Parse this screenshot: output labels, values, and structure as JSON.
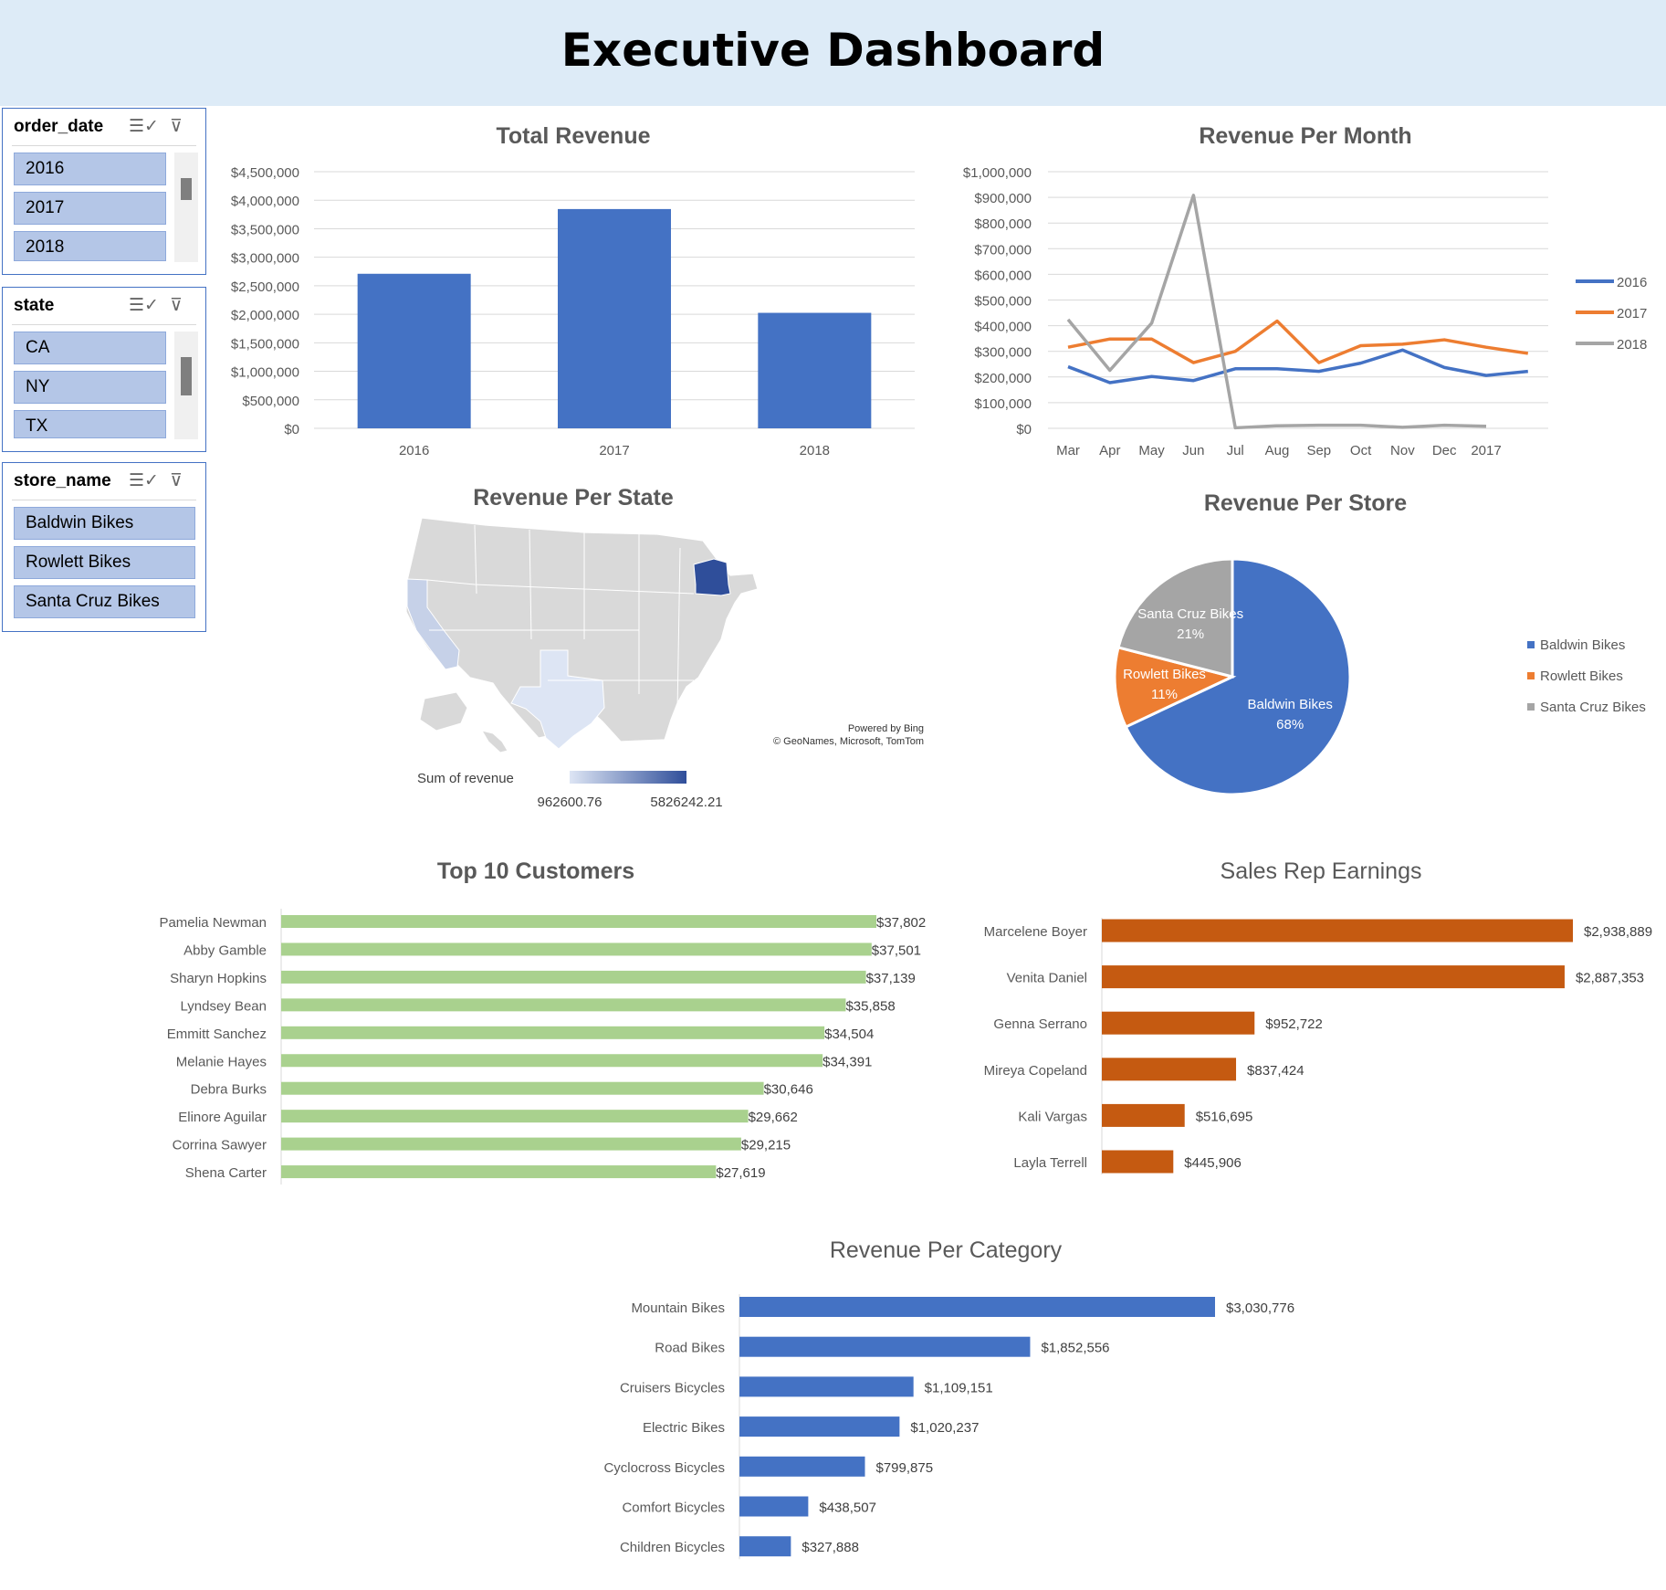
{
  "dashboard": {
    "title": "Executive Dashboard"
  },
  "slicers": [
    {
      "title": "order_date",
      "items": [
        "2016",
        "2017",
        "2018"
      ]
    },
    {
      "title": "state",
      "items": [
        "CA",
        "NY",
        "TX"
      ]
    },
    {
      "title": "store_name",
      "items": [
        "Baldwin Bikes",
        "Rowlett Bikes",
        "Santa Cruz Bikes"
      ]
    }
  ],
  "icons": {
    "multi_select": "multi-select-icon",
    "clear_filter": "clear-filter-icon"
  },
  "colors": {
    "blue": "#4472c4",
    "orange": "#ed7d31",
    "gray": "#a5a5a5",
    "green": "#a9d18e",
    "rust": "#c55a11",
    "banner": "#ddebf7",
    "map_low": "#dde5f4",
    "map_high": "#2f4e9a",
    "map_base": "#d9d9d9"
  },
  "chart_data": [
    {
      "id": "total_revenue",
      "type": "bar",
      "title": "Total Revenue",
      "categories": [
        "2016",
        "2017",
        "2018"
      ],
      "values": [
        2710000,
        3845000,
        2025000
      ],
      "ylim": [
        0,
        4500000
      ],
      "yticks": [
        "$0",
        "$500,000",
        "$1,000,000",
        "$1,500,000",
        "$2,000,000",
        "$2,500,000",
        "$3,000,000",
        "$3,500,000",
        "$4,000,000",
        "$4,500,000"
      ],
      "grid": true
    },
    {
      "id": "revenue_per_month",
      "type": "line",
      "title": "Revenue Per Month",
      "categories": [
        "Mar",
        "Apr",
        "May",
        "Jun",
        "Jul",
        "Aug",
        "Sep",
        "Oct",
        "Nov",
        "Dec",
        "2017",
        ""
      ],
      "ylim": [
        0,
        1000000
      ],
      "yticks": [
        "$0",
        "$100,000",
        "$200,000",
        "$300,000",
        "$400,000",
        "$500,000",
        "$600,000",
        "$700,000",
        "$800,000",
        "$900,000",
        "$1,000,000"
      ],
      "series": [
        {
          "name": "2016",
          "color": "#4472c4",
          "values": [
            240000,
            178000,
            202000,
            186000,
            232000,
            232000,
            222000,
            254000,
            305000,
            237000,
            206000,
            222000
          ]
        },
        {
          "name": "2017",
          "color": "#ed7d31",
          "values": [
            316000,
            348000,
            348000,
            256000,
            300000,
            418000,
            256000,
            322000,
            328000,
            345000,
            316000,
            292000
          ]
        },
        {
          "name": "2018",
          "color": "#a5a5a5",
          "values": [
            424000,
            226000,
            410000,
            908000,
            2000,
            10000,
            12000,
            12000,
            4000,
            12000,
            8000,
            null
          ]
        }
      ],
      "legend": "right",
      "grid": true
    },
    {
      "id": "revenue_per_state",
      "type": "map",
      "title": "Revenue Per State",
      "states": [
        {
          "name": "CA",
          "value": 1605823.03
        },
        {
          "name": "NY",
          "value": 5826242.21
        },
        {
          "name": "TX",
          "value": 962600.76
        }
      ],
      "legend_label": "Sum of revenue",
      "legend_min": "962600.76",
      "legend_max": "5826242.21",
      "credit_line1": "Powered by Bing",
      "credit_line2": "© GeoNames, Microsoft, TomTom"
    },
    {
      "id": "revenue_per_store",
      "type": "pie",
      "title": "Revenue Per Store",
      "slices": [
        {
          "name": "Baldwin Bikes",
          "value": 68,
          "label": "68%",
          "color": "#4472c4"
        },
        {
          "name": "Rowlett Bikes",
          "value": 11,
          "label": "11%",
          "color": "#ed7d31"
        },
        {
          "name": "Santa Cruz Bikes",
          "value": 21,
          "label": "21%",
          "color": "#a5a5a5"
        }
      ],
      "legend": "right"
    },
    {
      "id": "top_customers",
      "type": "bar",
      "orientation": "horizontal",
      "title": "Top 10 Customers",
      "categories": [
        "Pamelia Newman",
        "Abby Gamble",
        "Sharyn Hopkins",
        "Lyndsey Bean",
        "Emmitt Sanchez",
        "Melanie Hayes",
        "Debra Burks",
        "Elinore Aguilar",
        "Corrina Sawyer",
        "Shena Carter"
      ],
      "values": [
        37802,
        37501,
        37139,
        35858,
        34504,
        34391,
        30646,
        29662,
        29215,
        27619
      ],
      "labels": [
        "$37,802",
        "$37,501",
        "$37,139",
        "$35,858",
        "$34,504",
        "$34,391",
        "$30,646",
        "$29,662",
        "$29,215",
        "$27,619"
      ],
      "color": "#a9d18e"
    },
    {
      "id": "sales_rep_earnings",
      "type": "bar",
      "orientation": "horizontal",
      "title": "Sales Rep Earnings",
      "categories": [
        "Marcelene Boyer",
        "Venita Daniel",
        "Genna Serrano",
        "Mireya Copeland",
        "Kali Vargas",
        "Layla Terrell"
      ],
      "values": [
        2938889,
        2887353,
        952722,
        837424,
        516695,
        445906
      ],
      "labels": [
        "$2,938,889",
        "$2,887,353",
        "$952,722",
        "$837,424",
        "$516,695",
        "$445,906"
      ],
      "color": "#c55a11"
    },
    {
      "id": "revenue_per_category",
      "type": "bar",
      "orientation": "horizontal",
      "title": "Revenue Per Category",
      "categories": [
        "Mountain Bikes",
        "Road Bikes",
        "Cruisers Bicycles",
        "Electric Bikes",
        "Cyclocross Bicycles",
        "Comfort Bicycles",
        "Children Bicycles"
      ],
      "values": [
        3030776,
        1852556,
        1109151,
        1020237,
        799875,
        438507,
        327888
      ],
      "labels": [
        "$3,030,776",
        "$1,852,556",
        "$1,109,151",
        "$1,020,237",
        "$799,875",
        "$438,507",
        "$327,888"
      ],
      "color": "#4472c4"
    }
  ]
}
